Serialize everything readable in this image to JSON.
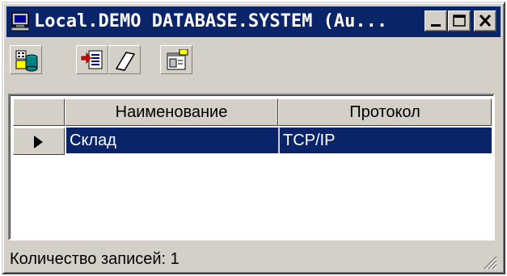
{
  "window": {
    "title": "Local.DEMO DATABASE.SYSTEM (Au...",
    "title_icon": "computer-icon",
    "controls": [
      "minimize-icon",
      "maximize-icon",
      "close-icon"
    ]
  },
  "toolbar": {
    "buttons": [
      {
        "name": "database-properties-button",
        "icon": "database-icon"
      },
      {
        "name": "add-record-button",
        "icon": "add-record-icon"
      },
      {
        "name": "erase-button",
        "icon": "eraser-icon"
      },
      {
        "name": "properties-button",
        "icon": "properties-icon"
      }
    ]
  },
  "grid": {
    "columns": [
      "Наименование",
      "Протокол"
    ],
    "rows": [
      {
        "name": "Склад",
        "protocol": "TCP/IP",
        "selected": true
      }
    ]
  },
  "status": {
    "records_label": "Количество записей: 1"
  },
  "colors": {
    "titlebar": "#0a246a",
    "selection": "#0a246a",
    "face": "#d4d0c8"
  }
}
